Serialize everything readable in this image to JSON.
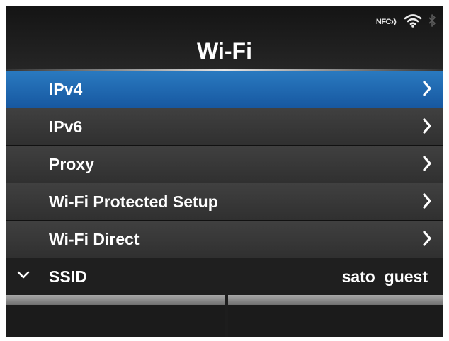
{
  "header": {
    "title": "Wi-Fi",
    "status_icons": [
      "nfc-icon",
      "wifi-icon",
      "bluetooth-icon"
    ],
    "nfc_text": "NFC"
  },
  "menu": {
    "items": [
      {
        "label": "IPv4",
        "selected": true,
        "icon": "chevron-right-icon"
      },
      {
        "label": "IPv6",
        "selected": false,
        "icon": "chevron-right-icon"
      },
      {
        "label": "Proxy",
        "selected": false,
        "icon": "chevron-right-icon"
      },
      {
        "label": "Wi-Fi Protected Setup",
        "selected": false,
        "icon": "chevron-right-icon"
      },
      {
        "label": "Wi-Fi Direct",
        "selected": false,
        "icon": "chevron-right-icon"
      }
    ]
  },
  "ssid": {
    "label": "SSID",
    "value": "sato_guest",
    "icon": "chevron-down-icon"
  },
  "softkeys": {
    "left": "",
    "right": ""
  },
  "colors": {
    "accent": "#1f6db5",
    "background": "#1d1d1d",
    "text": "#ffffff"
  }
}
